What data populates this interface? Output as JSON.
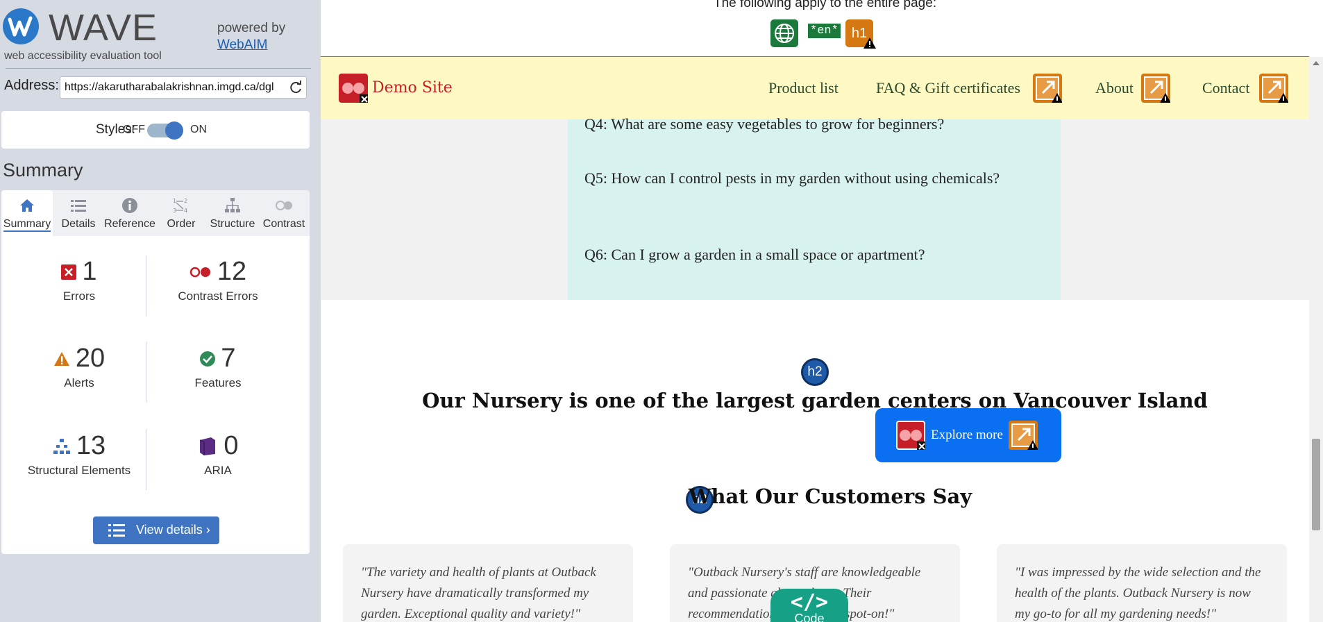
{
  "wave": {
    "title": "WAVE",
    "tagline": "web accessibility evaluation tool",
    "powered_by": "powered by",
    "webaim_link": "WebAIM"
  },
  "address": {
    "label": "Address:",
    "value": "https://akarutharabalakrishnan.imgd.ca/dgl"
  },
  "styles": {
    "label": "Styles:",
    "off": "OFF",
    "on": "ON",
    "enabled": true
  },
  "summary_heading": "Summary",
  "tabs": [
    {
      "label": "Summary",
      "icon": "home-icon",
      "active": true
    },
    {
      "label": "Details",
      "icon": "list-icon",
      "active": false
    },
    {
      "label": "Reference",
      "icon": "info-icon",
      "active": false
    },
    {
      "label": "Order",
      "icon": "order-icon",
      "active": false
    },
    {
      "label": "Structure",
      "icon": "structure-icon",
      "active": false
    },
    {
      "label": "Contrast",
      "icon": "contrast-icon",
      "active": false
    }
  ],
  "stats": {
    "errors": {
      "count": "1",
      "label": "Errors"
    },
    "contrast_errors": {
      "count": "12",
      "label": "Contrast Errors"
    },
    "alerts": {
      "count": "20",
      "label": "Alerts"
    },
    "features": {
      "count": "7",
      "label": "Features"
    },
    "structural": {
      "count": "13",
      "label": "Structural Elements"
    },
    "aria": {
      "count": "0",
      "label": "ARIA"
    }
  },
  "view_details_label": "View details ›",
  "page": {
    "applies_text": "The following apply to the entire page:",
    "lang_badge": "*en*",
    "h1_badge": "h1",
    "site_name": "Demo Site",
    "nav": [
      "Product list",
      "FAQ & Gift certificates",
      "About",
      "Contact"
    ],
    "faq": [
      "Q4: What are some easy vegetables to grow for beginners?",
      "Q5: How can I control pests in my garden without using chemicals?",
      "Q6: Can I grow a garden in a small space or apartment?"
    ],
    "h2_badge": "h2",
    "nursery_heading": "Our Nursery is one of the largest garden centers on Vancouver Island",
    "explore_label": "Explore more",
    "customers_heading": "What Our Customers Say",
    "testimonials": [
      "\"The variety and health of plants at Outback Nursery have dramatically transformed my garden. Exceptional quality and variety!\"",
      "\"Outback Nursery's staff are knowledgeable and passionate about plants. Their recommendations are always spot-on!\"",
      "\"I was impressed by the wide selection and the health of the plants. Outback Nursery is now my go-to for all my gardening needs!\""
    ],
    "code_glyph": "</>",
    "code_label": "Code"
  },
  "colors": {
    "sidebar_bg": "#d5dae3",
    "accent_blue": "#3f74c2",
    "error_red": "#c61f27",
    "alert_orange": "#d67812",
    "feature_green": "#2e8b57",
    "aria_purple": "#5b2c83",
    "nav_bg": "#fef9c3",
    "faq_bg": "#d8f2f0",
    "explore_btn": "#0a6ff0",
    "code_btn": "#16a085"
  }
}
